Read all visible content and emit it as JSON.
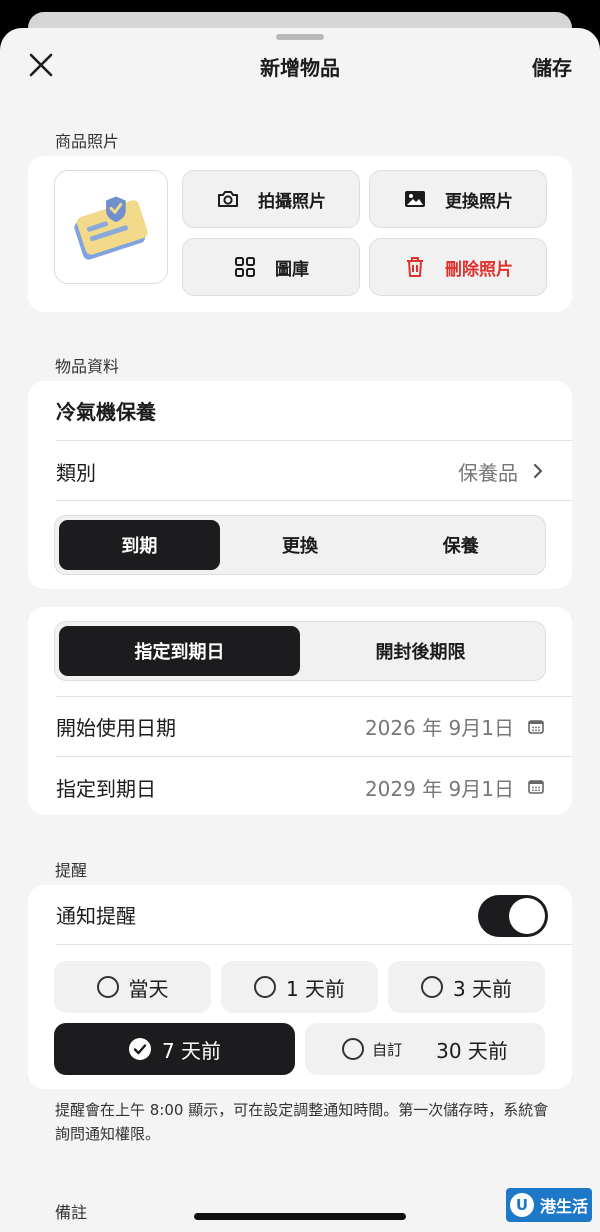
{
  "header": {
    "title": "新增物品",
    "save_label": "儲存"
  },
  "photo_section": {
    "label": "商品照片",
    "buttons": {
      "take_photo": "拍攝照片",
      "replace_photo": "更換照片",
      "gallery": "圖庫",
      "delete_photo": "刪除照片"
    }
  },
  "item_info": {
    "label": "物品資料",
    "name_value": "冷氣機保養",
    "category_label": "類別",
    "category_value": "保養品",
    "type_options": [
      "到期",
      "更換",
      "保養"
    ],
    "type_selected": "到期"
  },
  "expiry": {
    "mode_options": [
      "指定到期日",
      "開封後期限"
    ],
    "mode_selected": "指定到期日",
    "start_label": "開始使用日期",
    "start_value": "2026 年 9月1日",
    "expiry_label": "指定到期日",
    "expiry_value": "2029 年 9月1日"
  },
  "reminder": {
    "label": "提醒",
    "notify_label": "通知提醒",
    "notify_on": true,
    "options": [
      "當天",
      "1 天前",
      "3 天前",
      "7 天前"
    ],
    "custom_label": "自訂",
    "custom_value": "30 天前",
    "selected": "7 天前",
    "note": "提醒會在上午 8:00 顯示，可在設定調整通知時間。第一次儲存時，系統會詢問通知權限。"
  },
  "remarks": {
    "label": "備註"
  },
  "watermark": {
    "text": "港生活",
    "mark": "U"
  },
  "colors": {
    "accent": "#1c1c1e",
    "danger": "#e0302c",
    "background": "#f4f4f4"
  }
}
